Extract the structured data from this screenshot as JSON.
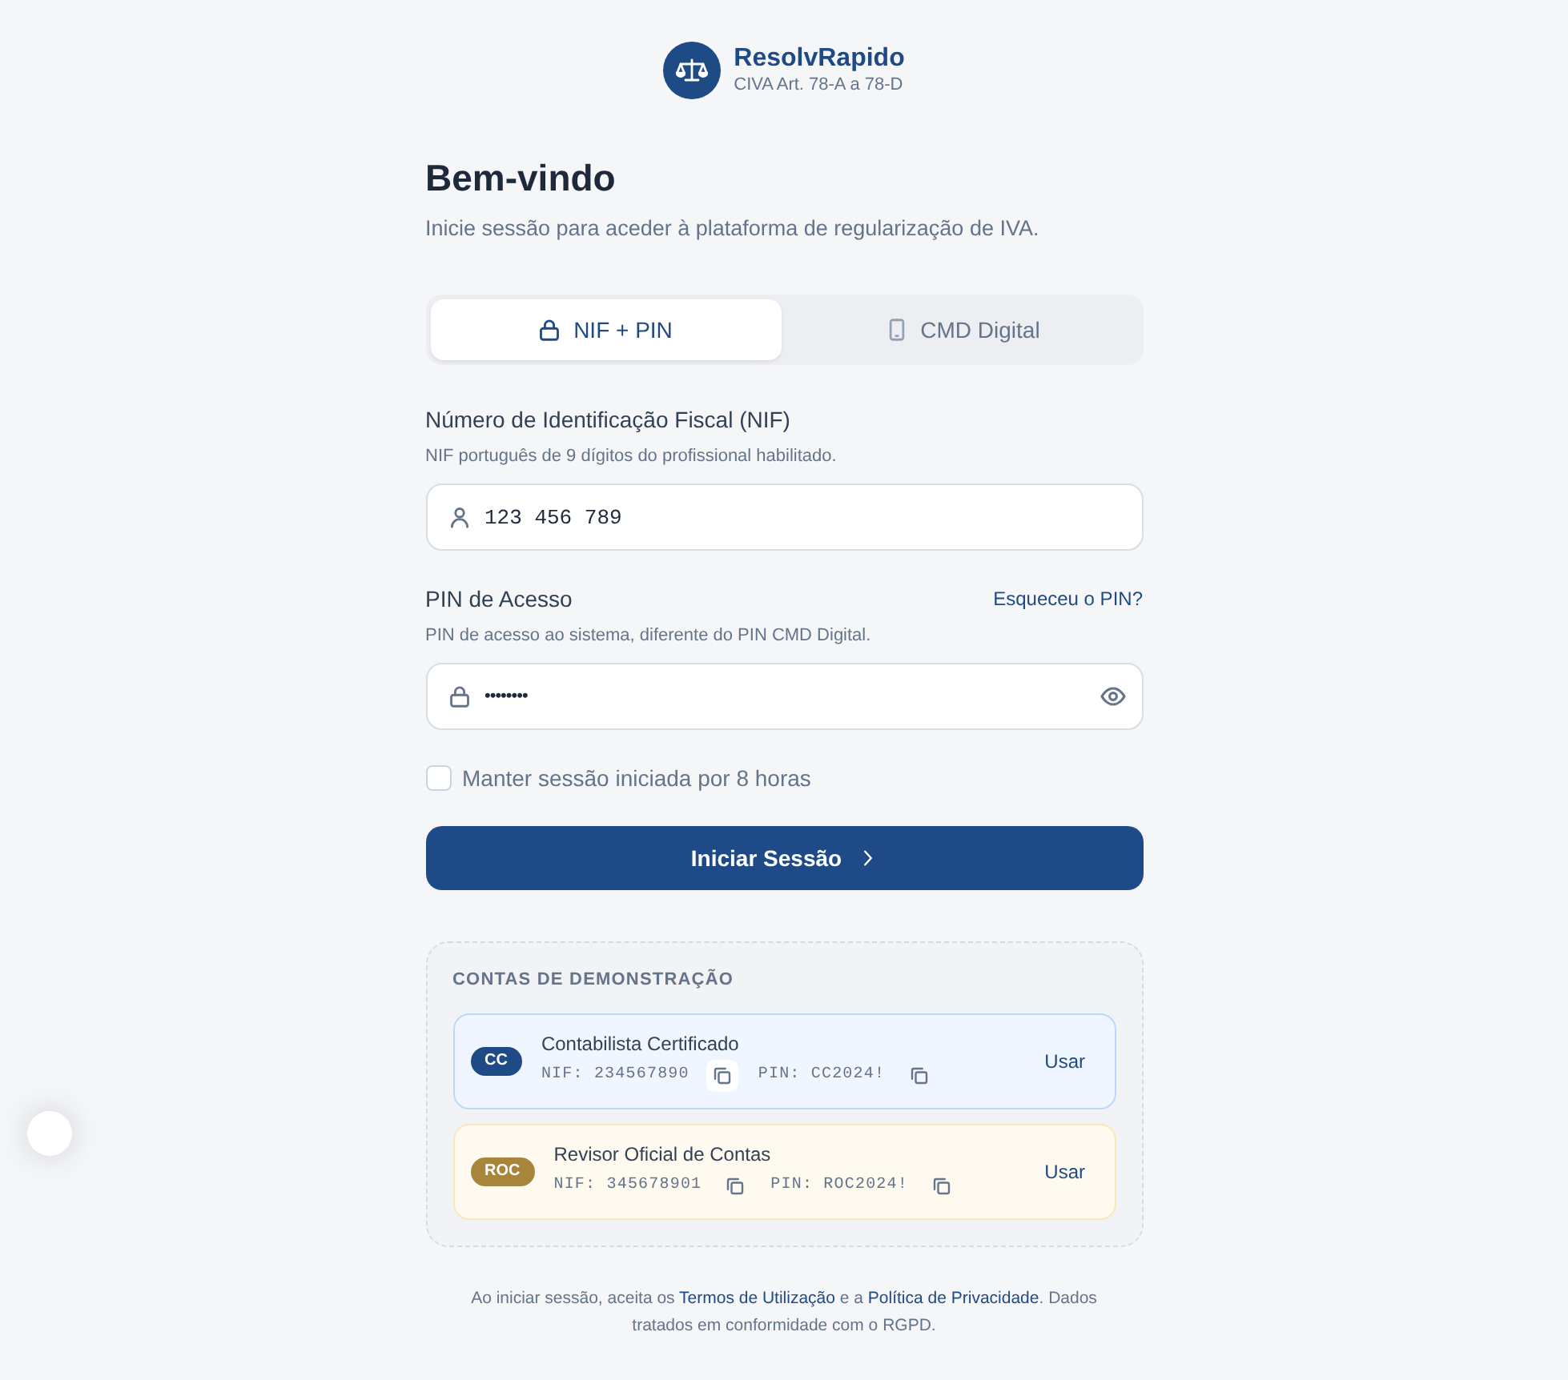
{
  "brand": {
    "name": "ResolvRapido",
    "subtitle": "CIVA Art. 78-A a 78-D"
  },
  "intro": {
    "title": "Bem-vindo",
    "subtitle": "Inicie sessão para aceder à plataforma de regularização de IVA."
  },
  "tabs": [
    {
      "label": "NIF + PIN",
      "selected": true
    },
    {
      "label": "CMD Digital",
      "selected": false
    }
  ],
  "fields": [
    {
      "kind": "text",
      "label": "Número de Identificação Fiscal (NIF)",
      "hint": "NIF português de 9 dígitos do profissional habilitado.",
      "value": "123 456 789"
    },
    {
      "kind": "password",
      "label": "PIN de Acesso",
      "link": "Esqueceu o PIN?",
      "hint": "PIN de acesso ao sistema, diferente do PIN CMD Digital.",
      "value": "••••••••"
    }
  ],
  "remember": {
    "label": "Manter sessão iniciada por 8 horas",
    "checked": false
  },
  "submit": {
    "label": "Iniciar Sessão"
  },
  "demo": {
    "title": "CONTAS DE DEMONSTRAÇÃO",
    "accounts": [
      {
        "badge": "CC",
        "color": "#1e4a85",
        "name": "Contabilista Certificado",
        "credentials": [
          {
            "text": "NIF: 234567890",
            "hovered": true
          },
          {
            "text": "PIN: CC2024!",
            "hovered": false
          }
        ],
        "action": "Usar"
      },
      {
        "badge": "ROC",
        "color": "#a8853a",
        "name": "Revisor Oficial de Contas",
        "credentials": [
          {
            "text": "NIF: 345678901",
            "hovered": false
          },
          {
            "text": "PIN: ROC2024!",
            "hovered": false
          }
        ],
        "action": "Usar"
      }
    ]
  },
  "footer": {
    "parts": [
      {
        "kind": "text",
        "text": "Ao iniciar sessão, aceita os "
      },
      {
        "kind": "link",
        "text": "Termos de Utilização"
      },
      {
        "kind": "text",
        "text": " e a "
      },
      {
        "kind": "link",
        "text": "Política de Privacidade"
      },
      {
        "kind": "text",
        "text": ". Dados tratados em conformidade com o RGPD."
      }
    ]
  }
}
